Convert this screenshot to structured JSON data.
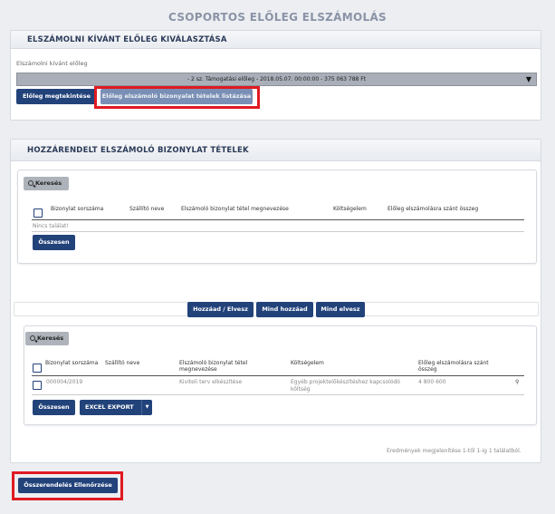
{
  "page_title": "CSOPORTOS ELŐLEG ELSZÁMOLÁS",
  "panel1": {
    "header": "ELSZÁMOLNI KÍVÁNT ELŐLEG KIVÁLASZTÁSA",
    "select_label": "Elszámolni kívánt előleg",
    "select_value": "- 2 sz. Támogatási előleg - 2018.05.07. 00:00:00 - 375 063 788 Ft",
    "btn_view": "Előleg megtekintése",
    "btn_list": "Előleg elszámoló bizonyalat tételek listázása"
  },
  "panel2": {
    "header": "HOZZÁRENDELT ELSZÁMOLÓ BIZONYLAT TÉTELEK",
    "search_btn": "Keresés",
    "columns": [
      "Bizonylat sorszáma",
      "Szállító neve",
      "Elszámoló bizonylat tétel megnevezése",
      "Költségelem",
      "Előleg elszámolásra szánt összeg"
    ],
    "empty_text": "Nincs találat!",
    "sum_btn": "Összesen"
  },
  "actions": {
    "add_remove": "Hozzáad / Elvesz",
    "add_all": "Mind hozzáad",
    "remove_all": "Mind elvesz"
  },
  "panel3": {
    "search_btn": "Keresés",
    "columns": [
      "Bizonylat sorszáma",
      "Szállító neve",
      "Elszámoló bizonylat tétel megnevezése",
      "Költségelem",
      "Előleg elszámolásra szánt összeg"
    ],
    "rows": [
      {
        "number": "000004/2019",
        "supplier": "",
        "name": "Kiviteli terv elkészítése",
        "cost": "Egyéb projektelőkészítéshez kapcsolódó költség",
        "amount": "4 800 600"
      }
    ],
    "sum_btn": "Összesen",
    "export_btn": "EXCEL EXPORT",
    "result_text": "Eredmények megjelenítése 1-től 1-ig 1 találatból."
  },
  "check_btn": "Összerendelés Ellenőrzése",
  "colors": {
    "primary": "#22427a",
    "highlight": "#e01a22"
  }
}
